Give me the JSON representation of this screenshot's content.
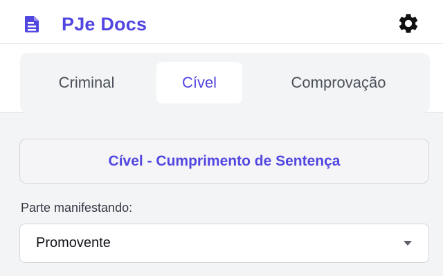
{
  "header": {
    "title": "PJe Docs",
    "logo_icon": "document-icon",
    "settings_icon": "gear-icon"
  },
  "tabs": [
    {
      "label": "Criminal",
      "active": false
    },
    {
      "label": "Cível",
      "active": true
    },
    {
      "label": "Comprovação",
      "active": false
    }
  ],
  "section": {
    "title": "Cível - Cumprimento de Sentença"
  },
  "form": {
    "party_label": "Parte manifestando:",
    "party_value": "Promovente"
  },
  "colors": {
    "accent": "#5146e0",
    "background": "#f3f4f6",
    "surface": "#ffffff"
  }
}
